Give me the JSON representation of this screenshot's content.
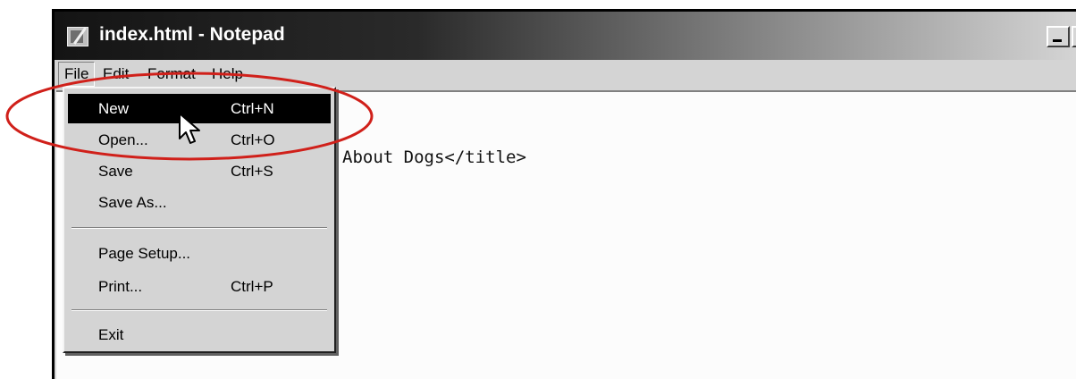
{
  "window": {
    "title": "index.html - Notepad"
  },
  "menubar": {
    "items": [
      {
        "label": "File"
      },
      {
        "label": "Edit"
      },
      {
        "label": "Format"
      },
      {
        "label": "Help"
      }
    ]
  },
  "editor": {
    "line_2": "About Dogs</title>"
  },
  "file_menu": {
    "items": [
      {
        "label": "New",
        "shortcut": "Ctrl+N"
      },
      {
        "label": "Open...",
        "shortcut": "Ctrl+O"
      },
      {
        "label": "Save",
        "shortcut": "Ctrl+S"
      },
      {
        "label": "Save As...",
        "shortcut": ""
      },
      {
        "label": "Page Setup...",
        "shortcut": ""
      },
      {
        "label": "Print...",
        "shortcut": "Ctrl+P"
      },
      {
        "label": "Exit",
        "shortcut": ""
      }
    ]
  },
  "annotation": {
    "color": "#d0201a"
  }
}
